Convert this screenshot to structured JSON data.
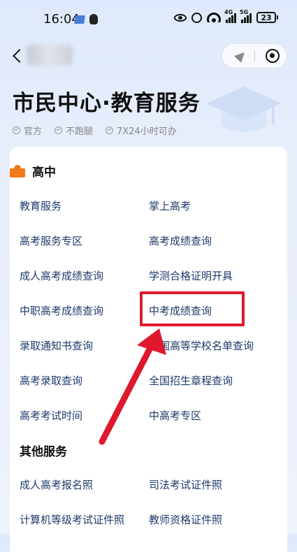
{
  "status_bar": {
    "time": "16:04",
    "signal_1": "4G",
    "signal_2": "5G",
    "battery": "23"
  },
  "page": {
    "title": "市民中心·教育服务",
    "badges": [
      "官方",
      "不跑腿",
      "7X24小时可办"
    ]
  },
  "sections": [
    {
      "heading": "高中",
      "items": [
        "教育服务",
        "掌上高考",
        "高考服务专区",
        "高考成绩查询",
        "成人高考成绩查询",
        "学测合格证明开具",
        "中职高考成绩查询",
        "中考成绩查询",
        "录取通知书查询",
        "全国高等学校名单查询",
        "高考录取查询",
        "全国招生章程查询",
        "高考考试时间",
        "中高考专区"
      ]
    },
    {
      "heading": "其他服务",
      "items": [
        "成人高考报名照",
        "司法考试证件照",
        "计算机等级考试证件照",
        "教师资格证件照"
      ]
    }
  ],
  "highlight": {
    "item": "中考成绩查询",
    "color": "#e0182d"
  },
  "colors": {
    "accent": "#f07a1a",
    "link": "#1f3a6b",
    "annotation": "#e0182d"
  }
}
